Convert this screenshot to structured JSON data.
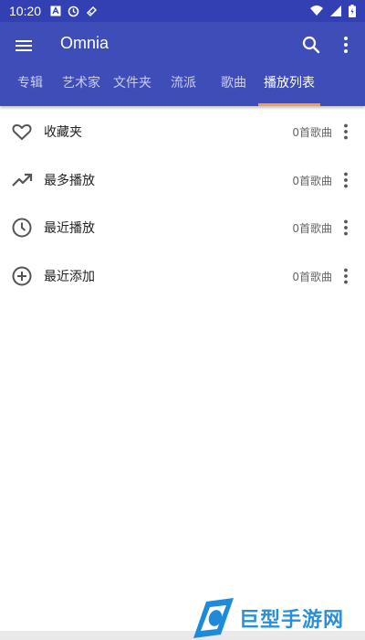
{
  "status_bar": {
    "time": "10:20",
    "left_icons": [
      "notification-a-icon",
      "clock-alarm-icon",
      "pencil-tag-icon"
    ],
    "right_icons": [
      "wifi-icon",
      "signal-icon",
      "battery-icon"
    ]
  },
  "app_bar": {
    "title": "Omnia",
    "icons": [
      "hamburger-menu-icon",
      "search-icon",
      "more-vert-icon"
    ]
  },
  "tabs": [
    {
      "label": "专辑",
      "active": false
    },
    {
      "label": "艺术家",
      "active": false
    },
    {
      "label": "文件夹",
      "active": false
    },
    {
      "label": "流派",
      "active": false
    },
    {
      "label": "歌曲",
      "active": false
    },
    {
      "label": "播放列表",
      "active": true
    }
  ],
  "playlists": [
    {
      "label": "收藏夹",
      "count": "0首歌曲",
      "icon": "heart-icon"
    },
    {
      "label": "最多播放",
      "count": "0首歌曲",
      "icon": "trending-up-icon"
    },
    {
      "label": "最近播放",
      "count": "0首歌曲",
      "icon": "clock-icon"
    },
    {
      "label": "最近添加",
      "count": "0首歌曲",
      "icon": "add-circle-icon"
    }
  ],
  "watermark": {
    "text": "巨型手游网"
  },
  "colors": {
    "primary": "#3f4db8",
    "status_bar": "#3340b3",
    "tab_indicator": "#ff9a3d",
    "watermark": "#2a8fd6"
  }
}
